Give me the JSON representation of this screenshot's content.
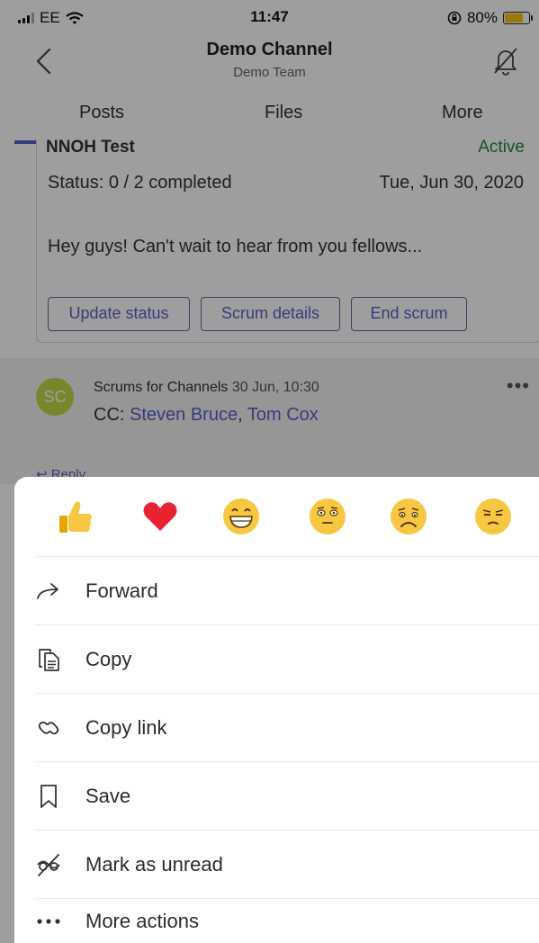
{
  "status_bar": {
    "carrier": "EE",
    "time": "11:47",
    "battery_text": "80%",
    "battery_level": 0.8,
    "battery_color": "#f5c518"
  },
  "header": {
    "back_icon": "chevron-left-icon",
    "title": "Demo Channel",
    "subtitle": "Demo Team",
    "bell_icon": "bell-off-icon"
  },
  "tabs": [
    {
      "label": "Posts",
      "active": true
    },
    {
      "label": "Files",
      "active": false
    },
    {
      "label": "More",
      "active": false
    }
  ],
  "scrum_card": {
    "partial_title": "NNOH Test",
    "state": "Active",
    "status": "Status: 0 / 2 completed",
    "date": "Tue, Jun 30, 2020",
    "message": "Hey guys! Can't wait to hear from you fellows...",
    "buttons": [
      "Update status",
      "Scrum details",
      "End scrum"
    ]
  },
  "post": {
    "avatar_initials": "SC",
    "author": "Scrums for Channels",
    "timestamp": "30 Jun, 10:30",
    "cc_label": "CC:",
    "mentions": [
      "Steven Bruce",
      "Tom Cox"
    ],
    "separator": ",",
    "more_icon": "more-horizontal-icon",
    "reply_label": "Reply"
  },
  "reactions": [
    {
      "name": "like",
      "icon": "thumbs-up-icon"
    },
    {
      "name": "heart",
      "icon": "heart-icon"
    },
    {
      "name": "laugh",
      "icon": "laughing-face-icon"
    },
    {
      "name": "surprised",
      "icon": "surprised-face-icon"
    },
    {
      "name": "sad",
      "icon": "sad-face-icon"
    },
    {
      "name": "angry",
      "icon": "angry-face-icon"
    }
  ],
  "actions": [
    {
      "label": "Forward",
      "icon": "forward-arrow-icon"
    },
    {
      "label": "Copy",
      "icon": "copy-icon"
    },
    {
      "label": "Copy link",
      "icon": "link-icon"
    },
    {
      "label": "Save",
      "icon": "bookmark-icon"
    },
    {
      "label": "Mark as unread",
      "icon": "mark-unread-icon"
    },
    {
      "label": "More actions",
      "icon": "more-horizontal-icon"
    }
  ],
  "colors": {
    "accent": "#5b5fc7",
    "active_state": "#1f8a3b",
    "avatar_bg": "#c2d847",
    "heart": "#e8232f",
    "emoji_yellow": "#f7c744"
  }
}
